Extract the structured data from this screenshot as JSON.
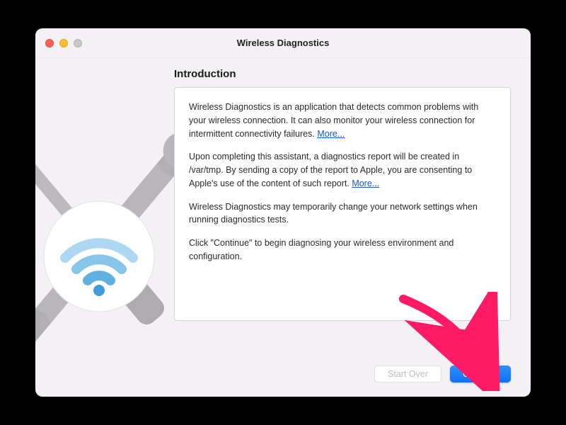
{
  "window": {
    "title": "Wireless Diagnostics"
  },
  "content": {
    "heading": "Introduction",
    "para1_text": "Wireless Diagnostics is an application that detects common problems with your wireless connection. It can also monitor your wireless connection for intermittent connectivity failures. ",
    "para1_more": "More...",
    "para2_text": "Upon completing this assistant, a diagnostics report will be created in /var/tmp. By sending a copy of the report to Apple, you are consenting to Apple's use of the content of such report. ",
    "para2_more": "More...",
    "para3_text": "Wireless Diagnostics may temporarily change your network settings when running diagnostics tests.",
    "para4_text": "Click \"Continue\" to begin diagnosing your wireless environment and configuration."
  },
  "buttons": {
    "start_over": "Start Over",
    "continue": "Continue"
  },
  "colors": {
    "accent": "#1070f5",
    "link": "#1557cf",
    "annotation": "#ff1a66"
  }
}
